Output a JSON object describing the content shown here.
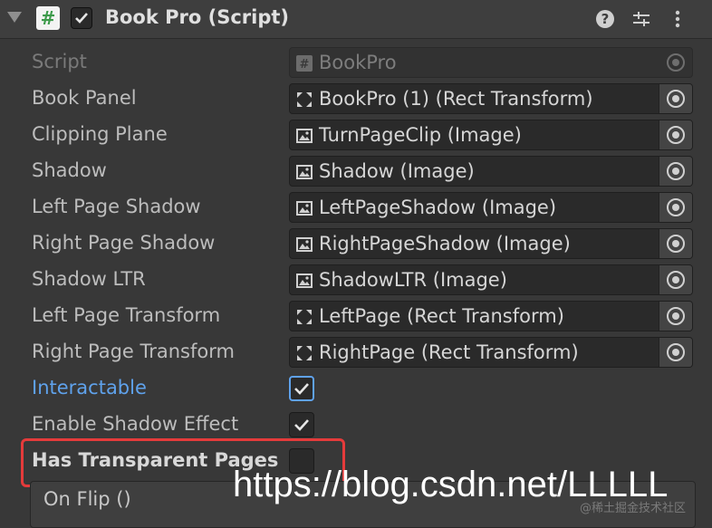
{
  "header": {
    "title": "Book Pro (Script)",
    "script_icon_glyph": "#",
    "enabled": true,
    "icons": [
      "help-icon",
      "preset-sliders-icon",
      "more-vert-icon"
    ]
  },
  "fields": [
    {
      "label": "Script",
      "value": "BookPro",
      "type": "script",
      "disabled": true
    },
    {
      "label": "Book Panel",
      "value": "BookPro (1) (Rect Transform)",
      "type": "recttransform"
    },
    {
      "label": "Clipping Plane",
      "value": "TurnPageClip (Image)",
      "type": "image"
    },
    {
      "label": "Shadow",
      "value": "Shadow (Image)",
      "type": "image"
    },
    {
      "label": "Left Page Shadow",
      "value": "LeftPageShadow (Image)",
      "type": "image"
    },
    {
      "label": "Right Page Shadow",
      "value": "RightPageShadow (Image)",
      "type": "image"
    },
    {
      "label": "Shadow LTR",
      "value": "ShadowLTR (Image)",
      "type": "image"
    },
    {
      "label": "Left Page Transform",
      "value": "LeftPage (Rect Transform)",
      "type": "recttransform"
    },
    {
      "label": "Right Page Transform",
      "value": "RightPage (Rect Transform)",
      "type": "recttransform"
    }
  ],
  "toggles": [
    {
      "label": "Interactable",
      "checked": true,
      "focused": true
    },
    {
      "label": "Enable Shadow Effect",
      "checked": true,
      "focused": false
    },
    {
      "label": "Has Transparent Pages",
      "checked": false,
      "focused": false
    }
  ],
  "event": {
    "title": "On Flip ()"
  },
  "watermark": {
    "text": "https://blog.csdn.net/LLLLL",
    "small": "@稀土掘金技术社区"
  },
  "colors": {
    "accent_blue": "#5fa2ec",
    "highlight_red": "#e53b3b",
    "background": "#383838"
  }
}
